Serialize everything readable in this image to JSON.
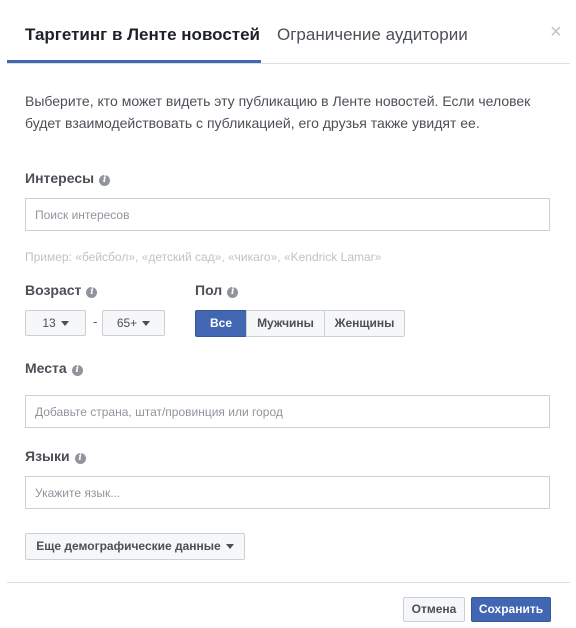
{
  "tabs": {
    "active_label": "Таргетинг в Ленте новостей",
    "inactive_label": "Ограничение аудитории",
    "close_glyph": "×"
  },
  "description": "Выберите, кто может видеть эту публикацию в Ленте новостей. Если человек будет взаимодействовать с публикацией, его друзья также увидят ее.",
  "interests": {
    "label": "Интересы",
    "placeholder": "Поиск интересов",
    "value": "",
    "hint": "Пример: «бейсбол», «детский сад», «чикаго», «Kendrick Lamar»"
  },
  "age": {
    "label": "Возраст",
    "min": "13",
    "separator": "-",
    "max": "65+"
  },
  "gender": {
    "label": "Пол",
    "options": [
      "Все",
      "Мужчины",
      "Женщины"
    ],
    "selected": "Все"
  },
  "places": {
    "label": "Места",
    "placeholder": "Добавьте страна, штат/провинция или город",
    "value": ""
  },
  "languages": {
    "label": "Языки",
    "placeholder": "Укажите язык...",
    "value": ""
  },
  "more_demographics_label": "Еще демографические данные",
  "footer": {
    "cancel_label": "Отмена",
    "save_label": "Сохранить"
  },
  "info_glyph": "i",
  "colors": {
    "accent": "#4267b2",
    "border": "#ccd0d5",
    "text": "#4b4f56"
  },
  "icons": [
    "close-icon",
    "info-icon",
    "caret-down-icon"
  ]
}
